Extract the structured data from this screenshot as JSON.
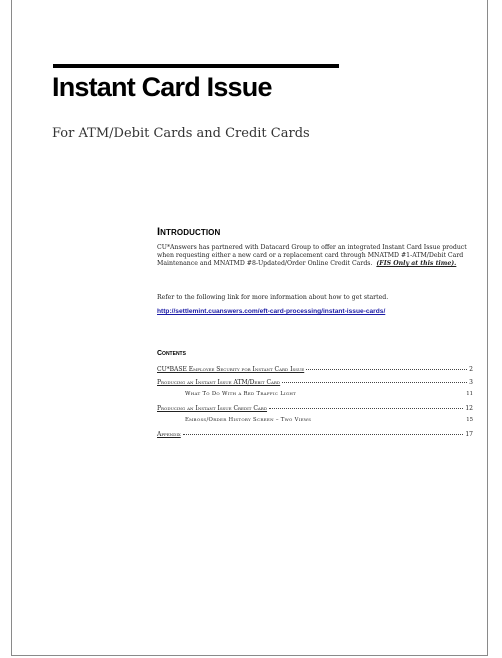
{
  "document": {
    "title": "Instant Card Issue",
    "subtitle": "For ATM/Debit Cards and Credit Cards"
  },
  "introduction": {
    "heading": "Introduction",
    "paragraph": "CU*Answers has partnered with Datacard Group to offer an integrated Instant Card Issue product when requesting either a new card or a replacement card through MNATMD #1-ATM/Debit Card Maintenance and MNATMD #8-Updated/Order Online Credit Cards.",
    "note": "(FIS Only at this time).",
    "reference": "Refer to the following link for more information about how to get started.",
    "link": "http://settlemint.cuanswers.com/eft-card-processing/instant-issue-cards/"
  },
  "contents": {
    "heading": "Contents",
    "entries": [
      {
        "label": "CU*BASE Employee Security for Instant Card Issue",
        "page": "2",
        "level": 1
      },
      {
        "label": "Producing an Instant Issue ATM/Debit Card",
        "page": "3",
        "level": 1
      },
      {
        "label": "What To Do With a Red Traffic Light",
        "page": "11",
        "level": 2
      },
      {
        "label": "Producing an Instant Issue Credit Card",
        "page": "12",
        "level": 1
      },
      {
        "label": "Emboss/Order History Screen – Two Views",
        "page": "15",
        "level": 2
      },
      {
        "label": "Appendix",
        "page": "17",
        "level": 1
      }
    ]
  }
}
